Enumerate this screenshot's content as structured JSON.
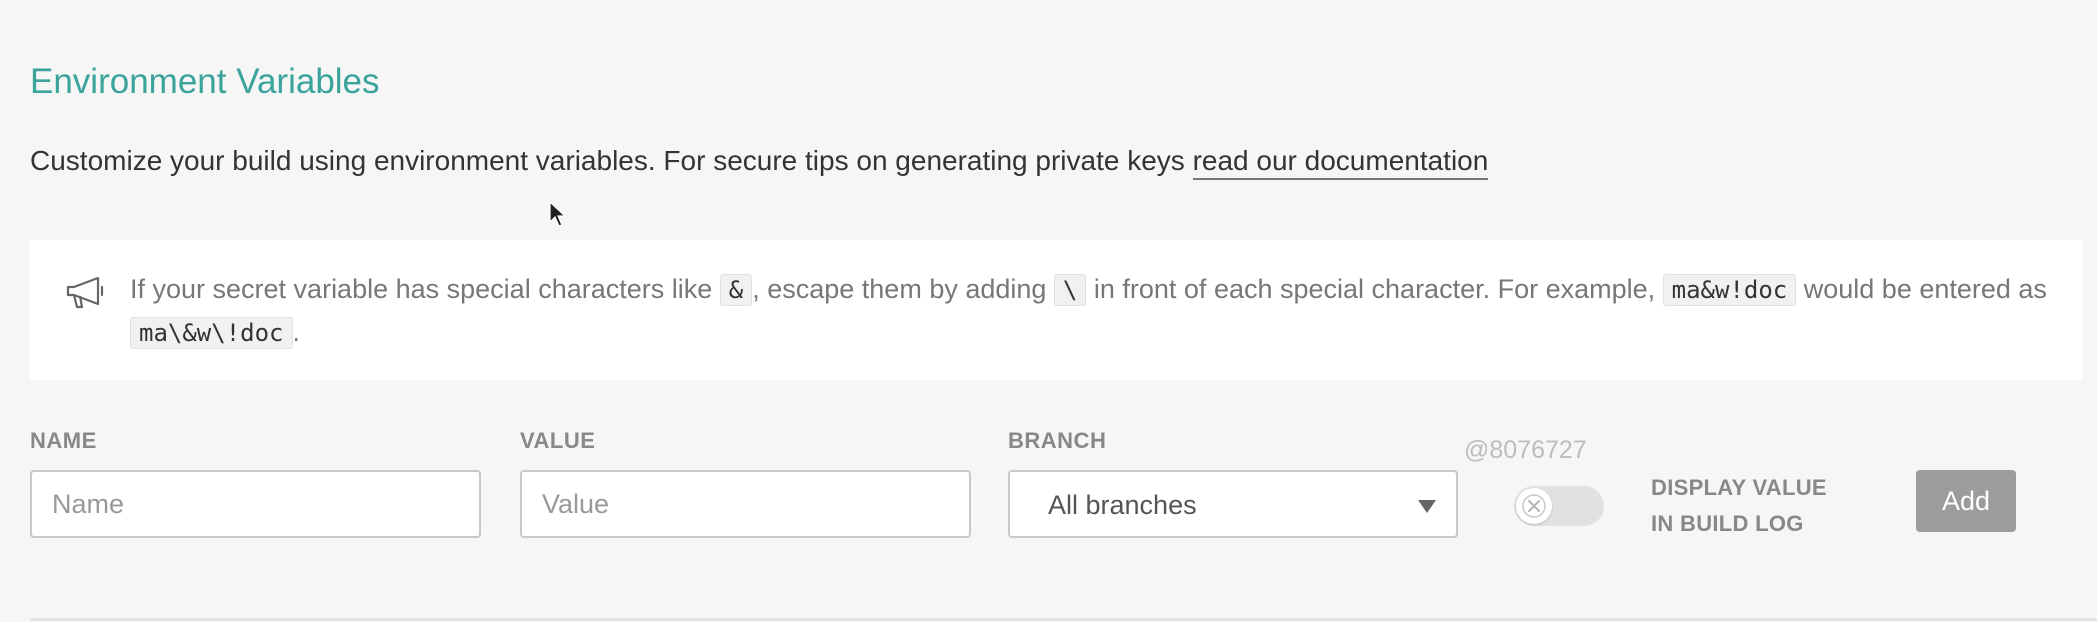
{
  "section": {
    "title": "Environment Variables",
    "intro_text": "Customize your build using environment variables. For secure tips on generating private keys ",
    "doc_link": "read our documentation"
  },
  "notice": {
    "icon": "megaphone-icon",
    "part1": "If your secret variable has special characters like ",
    "code1": "&",
    "part2": ", escape them by adding ",
    "code2": "\\",
    "part3": " in front of each special character. For example, ",
    "code3": "ma&w!doc",
    "part4": " would be entered as ",
    "code4": "ma\\&w\\!doc",
    "part5": "."
  },
  "form": {
    "name_label": "NAME",
    "name_placeholder": "Name",
    "value_label": "VALUE",
    "value_placeholder": "Value",
    "branch_label": "BRANCH",
    "branch_selected": "All branches",
    "display_toggle_on": false,
    "display_label": "DISPLAY VALUE IN BUILD LOG",
    "add_label": "Add"
  },
  "watermark": "@8076727",
  "colors": {
    "accent": "#3aa39a",
    "add_button": "#9c9c9c",
    "background": "#f6f6f6"
  }
}
